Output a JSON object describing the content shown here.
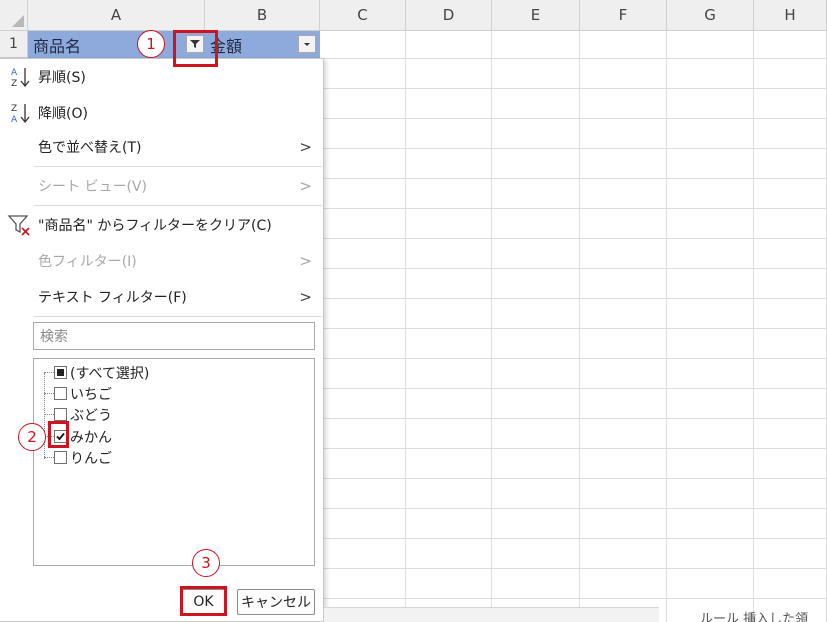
{
  "columns": [
    "A",
    "B",
    "C",
    "D",
    "E",
    "F",
    "G",
    "H"
  ],
  "rows": [
    "1"
  ],
  "header_cells": {
    "a1": "商品名",
    "b1": "金額"
  },
  "menu": {
    "sort_asc": "昇順(S)",
    "sort_desc": "降順(O)",
    "sort_by_color": "色で並べ替え(T)",
    "sheet_view": "シート ビュー(V)",
    "clear_filter": "\"商品名\" からフィルターをクリア(C)",
    "color_filter": "色フィルター(I)",
    "text_filter": "テキスト フィルター(F)",
    "chevron": ">"
  },
  "search": {
    "placeholder": "検索"
  },
  "filter_list": [
    {
      "label": "(すべて選択)",
      "state": "partial"
    },
    {
      "label": "いちご",
      "state": "unchecked"
    },
    {
      "label": "ぶどう",
      "state": "unchecked"
    },
    {
      "label": "みかん",
      "state": "checked"
    },
    {
      "label": "りんご",
      "state": "unchecked"
    }
  ],
  "buttons": {
    "ok": "OK",
    "cancel": "キャンセル"
  },
  "annotations": {
    "step1": "1",
    "step2": "2",
    "step3": "3"
  },
  "bottom_text": "ルール 挿入した領",
  "colors": {
    "header_fill": "#8ea9db",
    "annotation_red": "#d0131e"
  }
}
